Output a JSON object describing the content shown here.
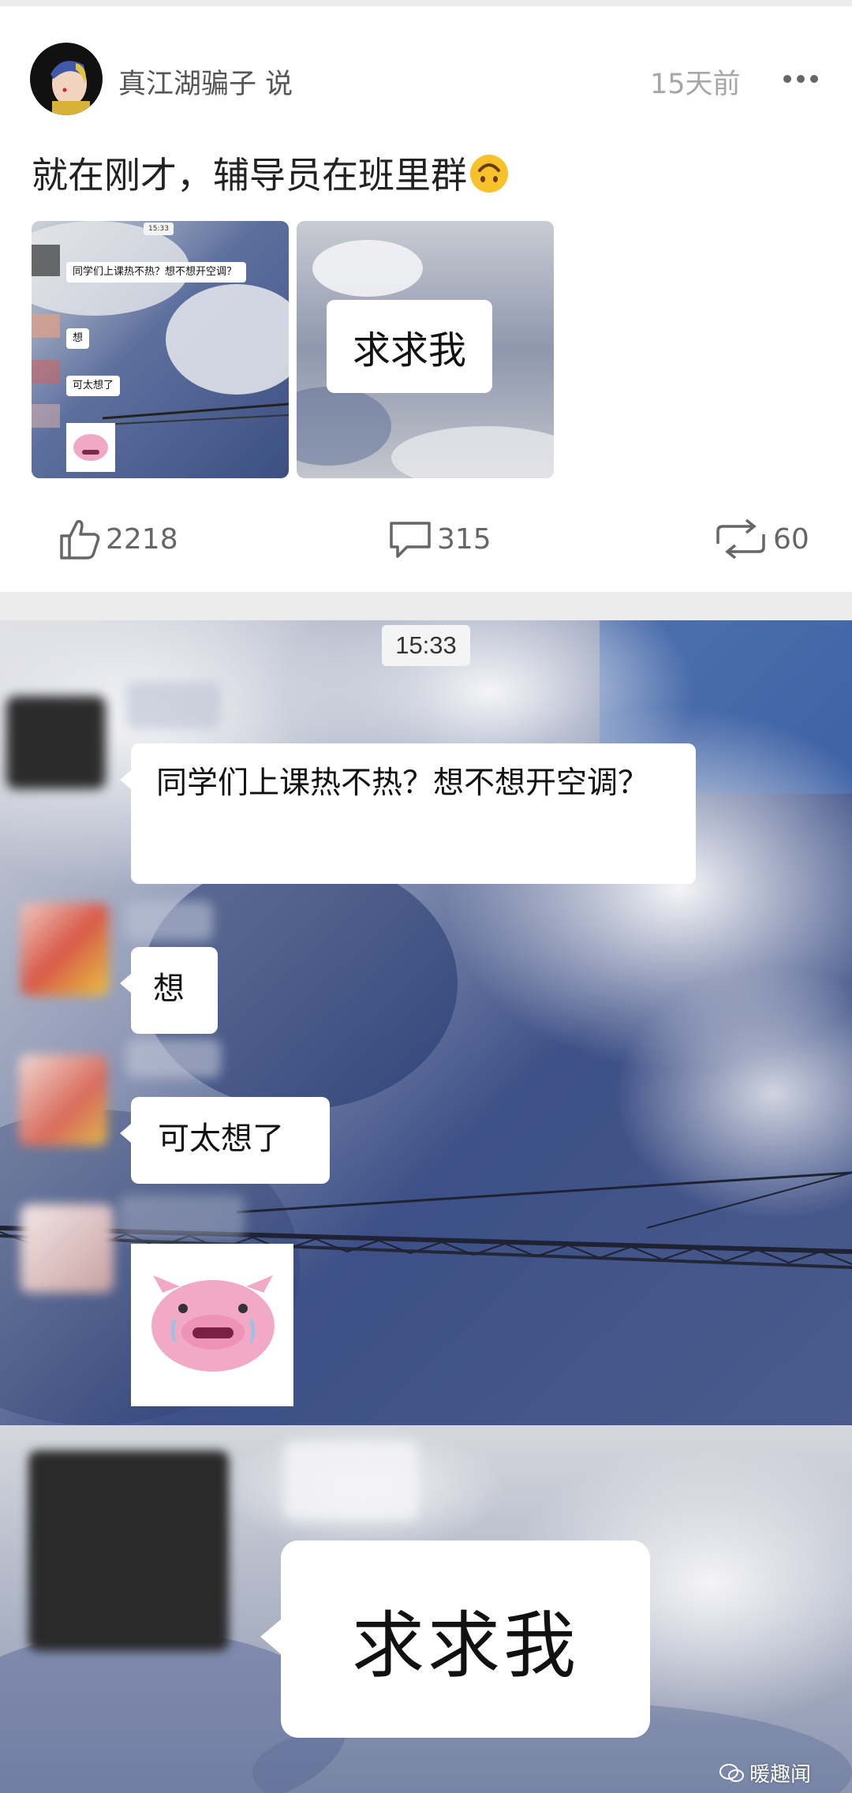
{
  "post": {
    "username": "真江湖骗子 说",
    "timestamp": "15天前",
    "text": "就在刚才，辅导员在班里群",
    "emoji": "upside-down-face",
    "thumbnails": [
      {
        "time": "15:33",
        "msg1": "同学们上课热不热？想不想开空调？",
        "msg2": "想",
        "msg3": "可太想了"
      },
      {
        "msg": "求求我"
      }
    ],
    "actions": {
      "likes": "2218",
      "comments": "315",
      "reposts": "60"
    }
  },
  "screenshot1": {
    "time": "15:33",
    "messages": [
      "同学们上课热不热？想不想开空调？",
      "想",
      "可太想了"
    ],
    "sticker": "crying-pig-sticker"
  },
  "screenshot2": {
    "message": "求求我"
  },
  "watermark": "暖趣闻",
  "colors": {
    "sky_blue": "#3f5f9a",
    "cloud": "#e9e9ec",
    "divider": "#ececec",
    "muted_text": "#a6a6a6"
  }
}
